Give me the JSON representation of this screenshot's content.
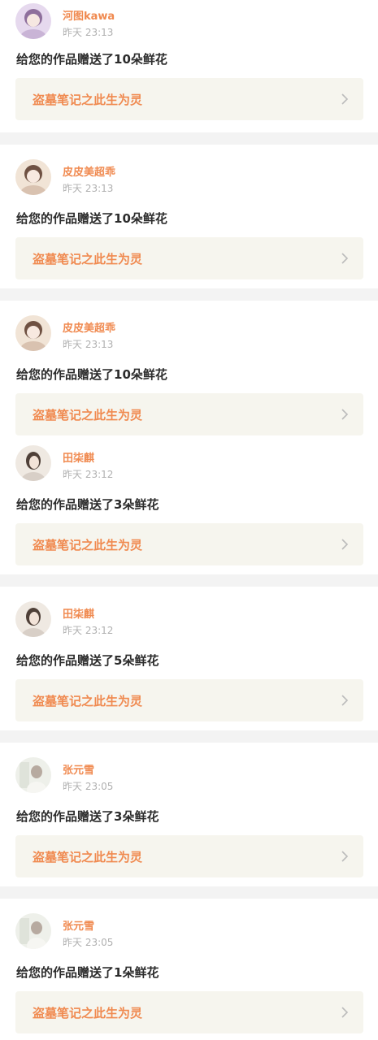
{
  "feed": {
    "items": [
      {
        "user": "河图kawa",
        "time": "昨天 23:13",
        "message": "给您的作品赠送了10朵鲜花",
        "work": "盗墓笔记之此生为灵",
        "avatar_icon": "avatar-anime-girl-icon",
        "avatar_colors": [
          "#e8d8f0",
          "#9a7aa8"
        ]
      },
      {
        "user": "皮皮美超乖",
        "time": "昨天 23:13",
        "message": "给您的作品赠送了10朵鲜花",
        "work": "盗墓笔记之此生为灵",
        "avatar_icon": "avatar-anime-girl-icon",
        "avatar_colors": [
          "#f3e6d8",
          "#7b5a4a"
        ]
      },
      {
        "user": "皮皮美超乖",
        "time": "昨天 23:13",
        "message": "给您的作品赠送了10朵鲜花",
        "work": "盗墓笔记之此生为灵",
        "avatar_icon": "avatar-anime-girl-icon",
        "avatar_colors": [
          "#f3e6d8",
          "#7b5a4a"
        ]
      },
      {
        "user": "田柒麒",
        "time": "昨天 23:12",
        "message": "给您的作品赠送了3朵鲜花",
        "work": "盗墓笔记之此生为灵",
        "avatar_icon": "avatar-portrait-icon",
        "avatar_colors": [
          "#efe9e2",
          "#5a4a40"
        ]
      },
      {
        "user": "田柒麒",
        "time": "昨天 23:12",
        "message": "给您的作品赠送了5朵鲜花",
        "work": "盗墓笔记之此生为灵",
        "avatar_icon": "avatar-portrait-icon",
        "avatar_colors": [
          "#efe9e2",
          "#5a4a40"
        ]
      },
      {
        "user": "张元雪",
        "time": "昨天 23:05",
        "message": "给您的作品赠送了3朵鲜花",
        "work": "盗墓笔记之此生为灵",
        "avatar_icon": "avatar-photo-icon",
        "avatar_colors": [
          "#eef0ea",
          "#b8bcb0"
        ]
      },
      {
        "user": "张元雪",
        "time": "昨天 23:05",
        "message": "给您的作品赠送了1朵鲜花",
        "work": "盗墓笔记之此生为灵",
        "avatar_icon": "avatar-photo-icon",
        "avatar_colors": [
          "#eef0ea",
          "#b8bcb0"
        ]
      }
    ]
  },
  "colors": {
    "accent": "#f08a50",
    "card_bg": "#ffffff",
    "page_bg": "#f3f3f3",
    "link_bg": "#f6f5ee",
    "text": "#2c2c2c",
    "muted": "#b0b0b0"
  },
  "icons": {
    "chevron": "chevron-right-icon"
  }
}
